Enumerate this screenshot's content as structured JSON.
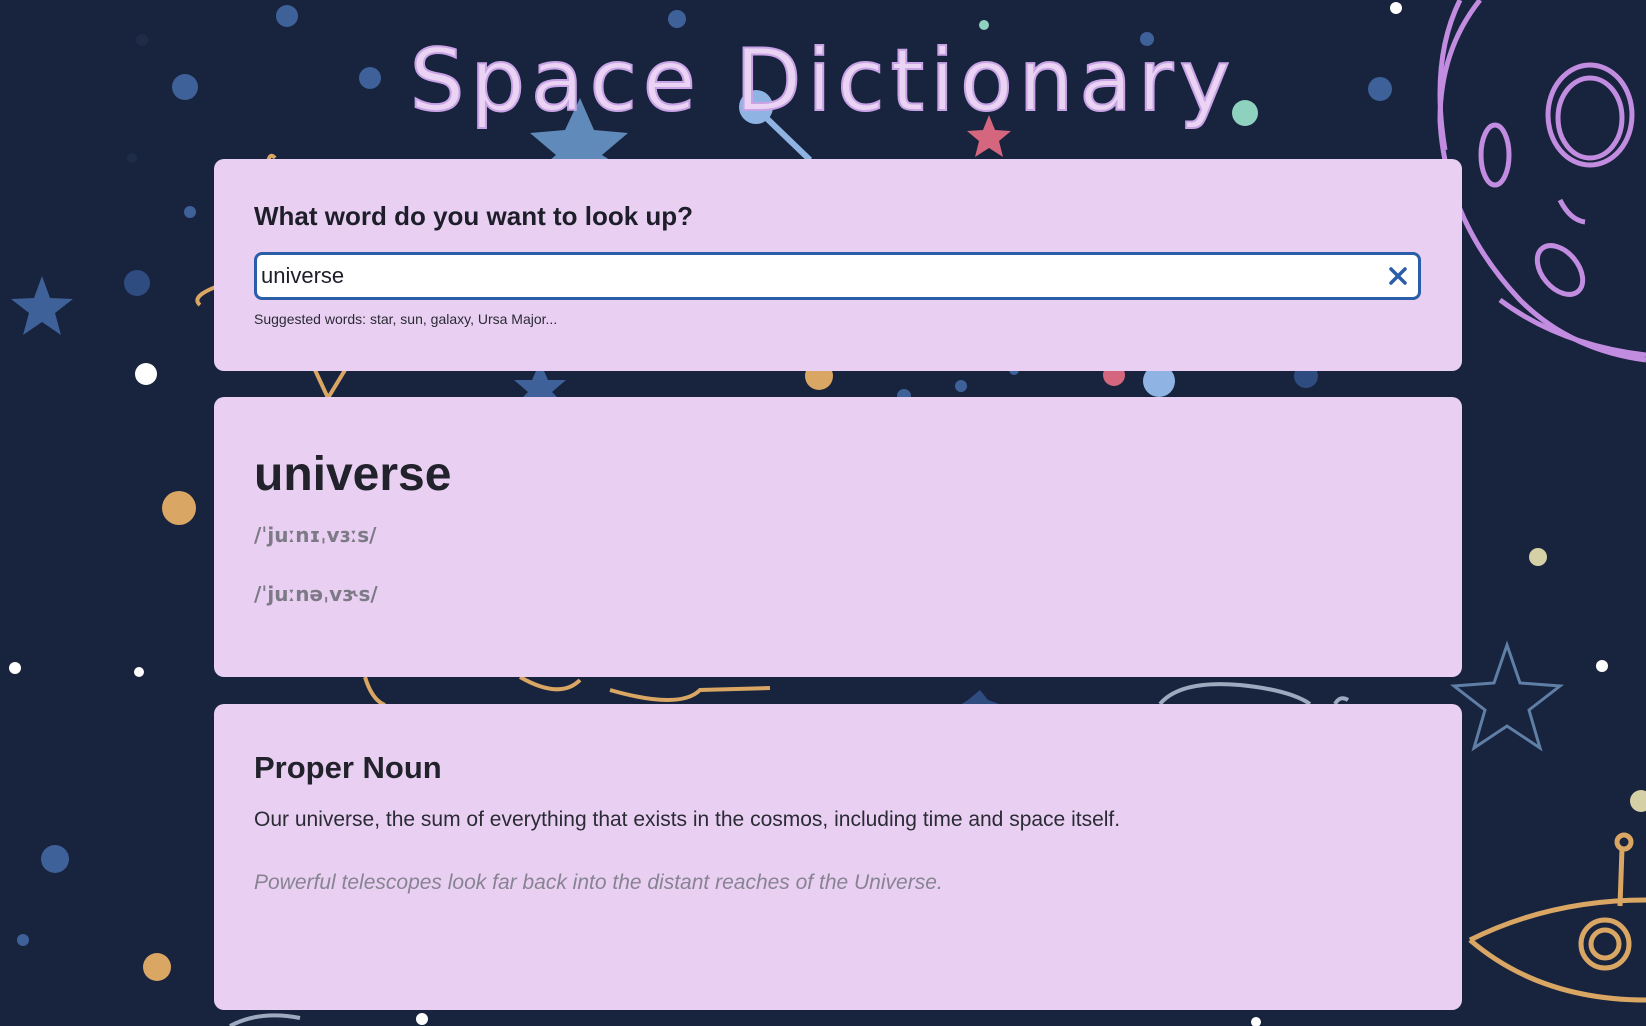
{
  "app": {
    "title": "Space Dictionary"
  },
  "search": {
    "prompt": "What word do you want to look up?",
    "value": "universe",
    "placeholder": "",
    "clear_icon": "close-icon",
    "suggested": "Suggested words: star, sun, galaxy, Ursa Major..."
  },
  "entry": {
    "word": "universe",
    "phonetics": [
      "/ˈjuːnɪˌvɜːs/",
      "/ˈjuːnəˌvɝs/"
    ]
  },
  "definition": {
    "part_of_speech": "Proper Noun",
    "text": "Our universe, the sum of everything that exists in the cosmos, including time and space itself.",
    "example": "Powerful telescopes look far back into the distant reaches of the Universe."
  },
  "colors": {
    "background": "#18233e",
    "card": "#e9d0f2",
    "input_border": "#2a5ea8",
    "title_fill": "#ead3f3",
    "title_stroke": "#c8a3e6"
  }
}
